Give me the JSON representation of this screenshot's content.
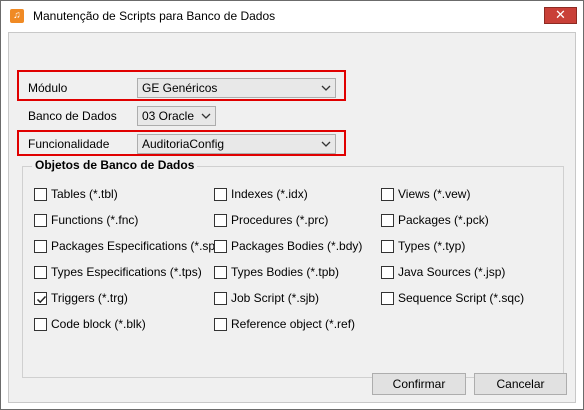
{
  "window": {
    "title": "Manutenção de Scripts para Banco de Dados",
    "app_icon": "app-logo-icon",
    "close_glyph": "✕"
  },
  "form": {
    "modulo_label": "Módulo",
    "modulo_value": "GE  Genéricos",
    "banco_label": "Banco de Dados",
    "banco_value": "03 Oracle",
    "funcionalidade_label": "Funcionalidade",
    "funcionalidade_value": "AuditoriaConfig",
    "highlight_color": "#e00000"
  },
  "objetos": {
    "title": "Objetos de Banco de Dados",
    "columns": [
      [
        {
          "label": "Tables (*.tbl)",
          "checked": false
        },
        {
          "label": "Functions (*.fnc)",
          "checked": false
        },
        {
          "label": "Packages Especifications (*.spc)",
          "checked": false
        },
        {
          "label": "Types Especifications (*.tps)",
          "checked": false
        },
        {
          "label": "Triggers (*.trg)",
          "checked": true
        },
        {
          "label": "Code block (*.blk)",
          "checked": false
        }
      ],
      [
        {
          "label": "Indexes (*.idx)",
          "checked": false
        },
        {
          "label": "Procedures (*.prc)",
          "checked": false
        },
        {
          "label": "Packages Bodies (*.bdy)",
          "checked": false
        },
        {
          "label": "Types Bodies (*.tpb)",
          "checked": false
        },
        {
          "label": "Job Script (*.sjb)",
          "checked": false
        },
        {
          "label": "Reference object (*.ref)",
          "checked": false
        }
      ],
      [
        {
          "label": "Views (*.vew)",
          "checked": false
        },
        {
          "label": "Packages (*.pck)",
          "checked": false
        },
        {
          "label": "Types (*.typ)",
          "checked": false
        },
        {
          "label": "Java Sources (*.jsp)",
          "checked": false
        },
        {
          "label": "Sequence Script (*.sqc)",
          "checked": false
        }
      ]
    ]
  },
  "buttons": {
    "confirmar": "Confirmar",
    "cancelar": "Cancelar"
  }
}
